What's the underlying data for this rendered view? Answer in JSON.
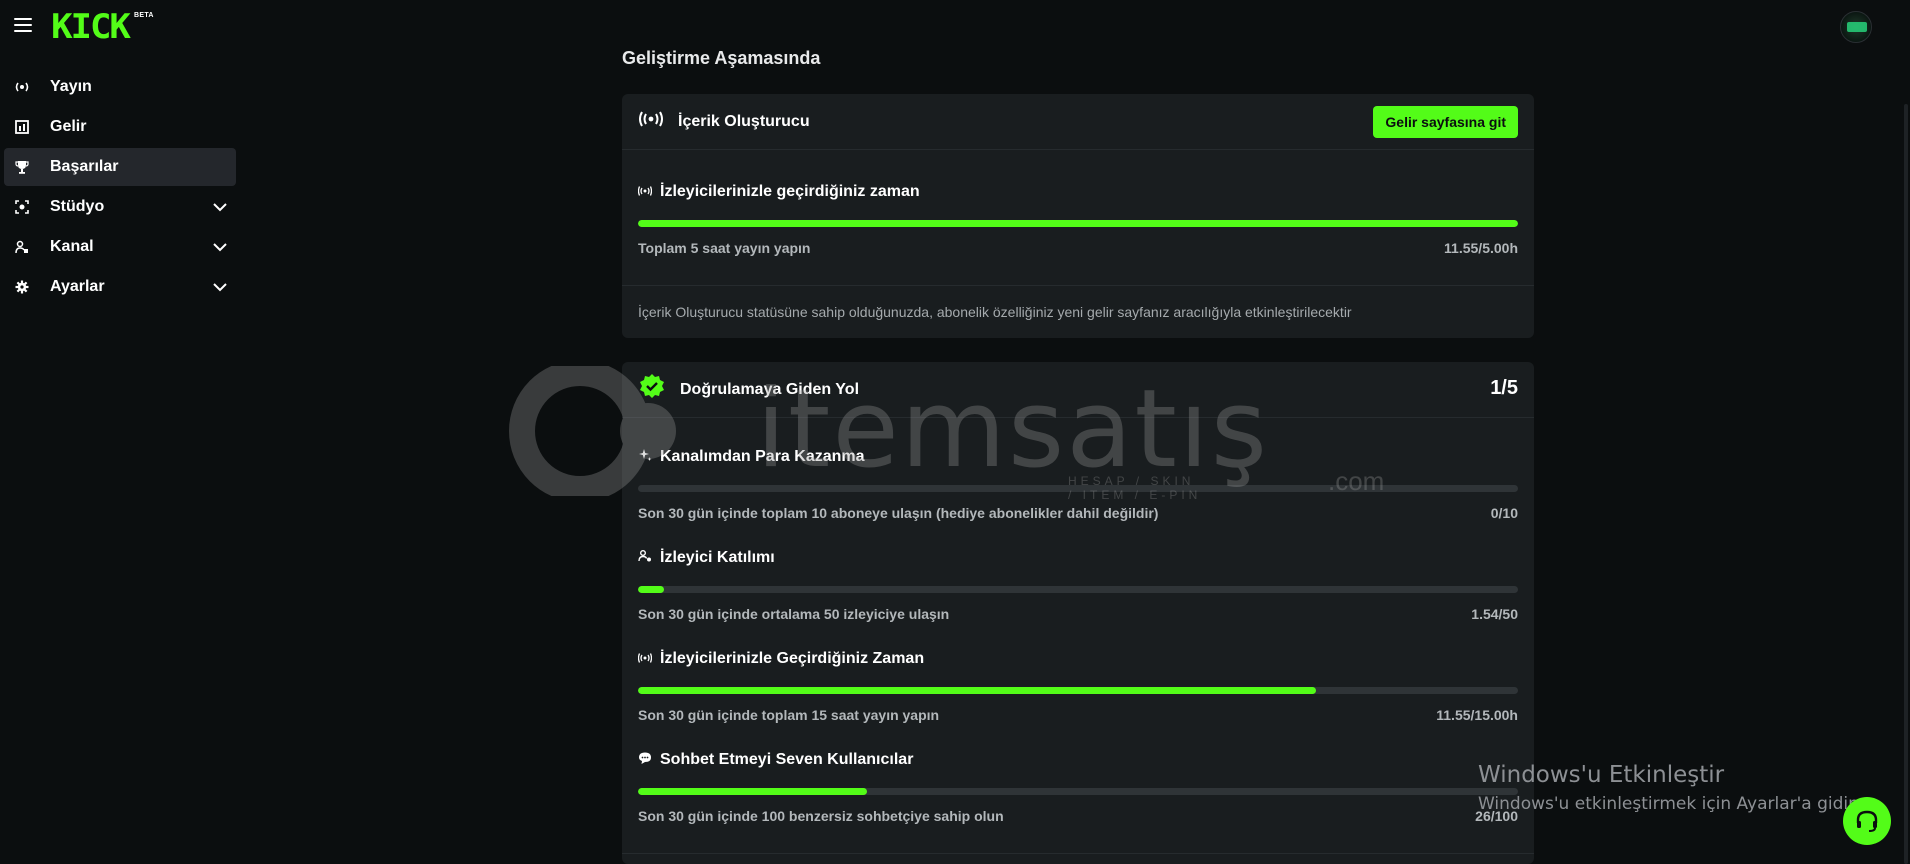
{
  "brand": {
    "logo_text": "KICK",
    "badge": "BETA",
    "accent": "#53fc18"
  },
  "sidebar": {
    "items": [
      {
        "label": "Yayın",
        "icon": "broadcast-icon",
        "active": false,
        "expandable": false
      },
      {
        "label": "Gelir",
        "icon": "revenue-icon",
        "active": false,
        "expandable": false
      },
      {
        "label": "Başarılar",
        "icon": "trophy-icon",
        "active": true,
        "expandable": false
      },
      {
        "label": "Stüdyo",
        "icon": "studio-icon",
        "active": false,
        "expandable": true
      },
      {
        "label": "Kanal",
        "icon": "channel-icon",
        "active": false,
        "expandable": true
      },
      {
        "label": "Ayarlar",
        "icon": "gear-icon",
        "active": false,
        "expandable": true
      }
    ]
  },
  "main": {
    "section_heading": "Geliştirme Aşamasında",
    "creator_card": {
      "title": "İçerik Oluşturucu",
      "button_label": "Gelir sayfasına git",
      "task": {
        "title": "İzleyicilerinizle geçirdiğiniz zaman",
        "description": "Toplam 5 saat yayın yapın",
        "value": "11.55/5.00h",
        "progress_percent": 100
      },
      "note": "İçerik Oluşturucu statüsüne sahip olduğunuzda, abonelik özelliğiniz yeni gelir sayfanız aracılığıyla etkinleştirilecektir"
    },
    "verification_card": {
      "title": "Doğrulamaya Giden Yol",
      "counter": "1/5",
      "tasks": [
        {
          "title": "Kanalımdan Para Kazanma",
          "icon": "sparkle-icon",
          "description": "Son 30 gün içinde toplam 10 aboneye ulaşın (hediye abonelikler dahil değildir)",
          "value": "0/10",
          "progress_percent": 0
        },
        {
          "title": "İzleyici Katılımı",
          "icon": "viewers-icon",
          "description": "Son 30 gün içinde ortalama 50 izleyiciye ulaşın",
          "value": "1.54/50",
          "progress_percent": 3
        },
        {
          "title": "İzleyicilerinizle Geçirdiğiniz Zaman",
          "icon": "broadcast-icon",
          "description": "Son 30 gün içinde toplam 15 saat yayın yapın",
          "value": "11.55/15.00h",
          "progress_percent": 77
        },
        {
          "title": "Sohbet Etmeyi Seven Kullanıcılar",
          "icon": "chat-icon",
          "description": "Son 30 gün içinde 100 benzersiz sohbetçiye sahip olun",
          "value": "26/100",
          "progress_percent": 26
        }
      ]
    }
  },
  "watermark": {
    "text": "itemsatış",
    "sub": "HESAP / SKIN / ITEM / E-PIN",
    "domain": ".com"
  },
  "windows_activation": {
    "title": "Windows'u Etkinleştir",
    "subtitle": "Windows'u etkinleştirmek için Ayarlar'a gidin."
  }
}
